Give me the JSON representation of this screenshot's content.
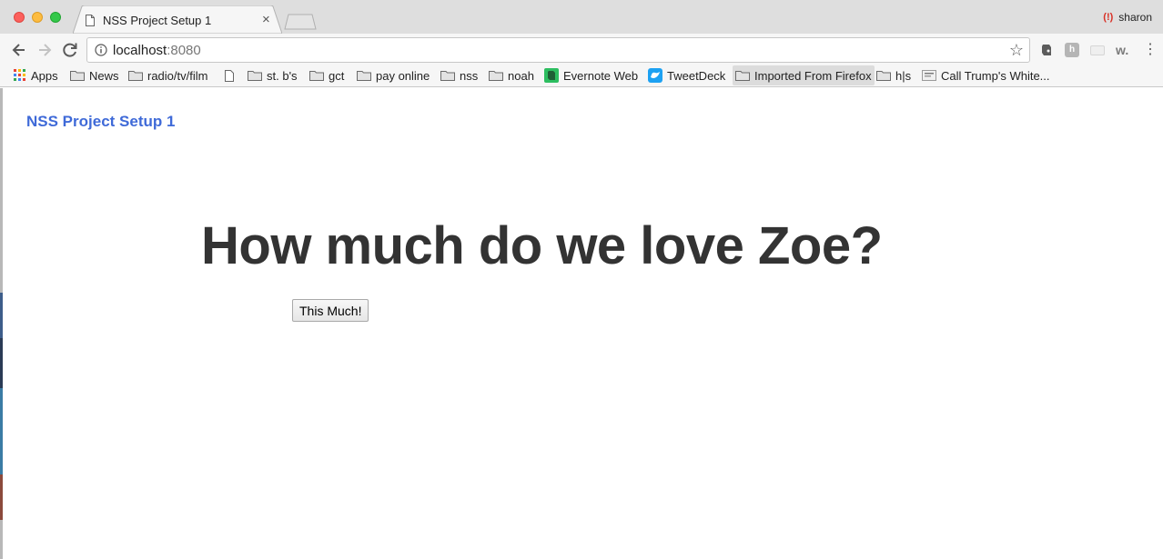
{
  "browser": {
    "tab": {
      "title": "NSS Project Setup 1",
      "close_symbol": "×"
    },
    "profile": {
      "name": "sharon",
      "icon": "profile-badge-icon"
    },
    "address": {
      "host": "localhost",
      "port": ":8080"
    },
    "star_symbol": "☆",
    "extensions": {
      "h_label": "h",
      "w_label": "w.",
      "menu_symbol": "⋮"
    }
  },
  "bookmarks": [
    {
      "label": "Apps",
      "icon": "apps-grid-icon"
    },
    {
      "label": "News",
      "icon": "folder-icon"
    },
    {
      "label": "radio/tv/film",
      "icon": "folder-icon"
    },
    {
      "label": "",
      "icon": "page-icon"
    },
    {
      "label": "st. b's",
      "icon": "folder-icon"
    },
    {
      "label": "gct",
      "icon": "folder-icon"
    },
    {
      "label": "pay online",
      "icon": "folder-icon"
    },
    {
      "label": "nss",
      "icon": "folder-icon"
    },
    {
      "label": "noah",
      "icon": "folder-icon"
    },
    {
      "label": "Evernote Web",
      "icon": "evernote-icon"
    },
    {
      "label": "TweetDeck",
      "icon": "tweetdeck-icon"
    },
    {
      "label": "Imported From Firefox",
      "icon": "folder-icon"
    },
    {
      "label": "h|s",
      "icon": "folder-icon"
    },
    {
      "label": "Call Trump's White...",
      "icon": "site-favicon-icon"
    }
  ],
  "page": {
    "site_title": "NSS Project Setup 1",
    "headline": "How much do we love Zoe?",
    "button_label": "This Much!"
  },
  "colors": {
    "accent_link": "#3f6ad8",
    "headline": "#333333",
    "tabstrip": "#dedede",
    "toolbar": "#f6f6f6"
  }
}
